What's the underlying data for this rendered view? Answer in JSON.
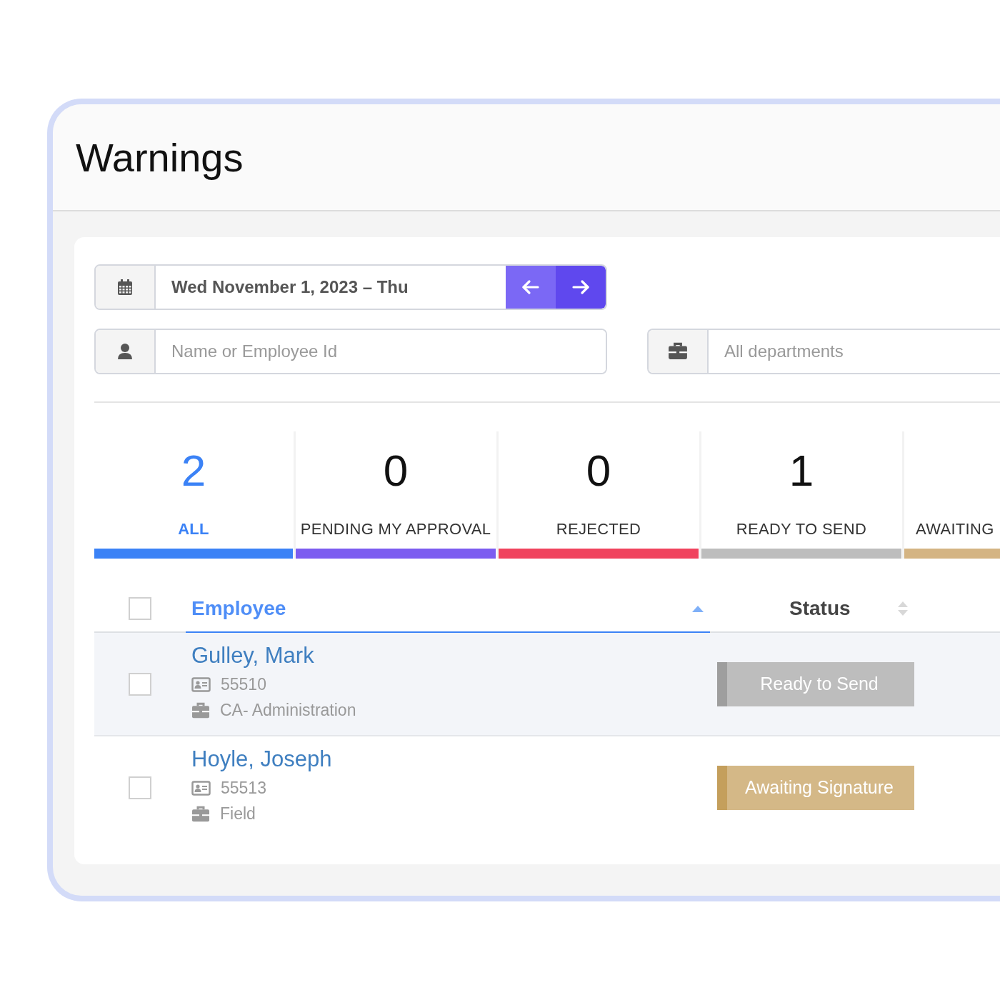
{
  "page": {
    "title": "Warnings"
  },
  "filters": {
    "date_range": "Wed November 1, 2023 – Thu",
    "search": {
      "placeholder": "Name or Employee Id"
    },
    "department": {
      "placeholder": "All departments"
    }
  },
  "tabs": [
    {
      "count": "2",
      "label": "ALL",
      "selected": true,
      "color": "#3b82f6"
    },
    {
      "count": "0",
      "label": "PENDING MY APPROVAL",
      "selected": false,
      "color": "#7c5cf0"
    },
    {
      "count": "0",
      "label": "REJECTED",
      "selected": false,
      "color": "#f0435e"
    },
    {
      "count": "1",
      "label": "READY TO SEND",
      "selected": false,
      "color": "#bdbdbd"
    },
    {
      "label": "AWAITING",
      "selected": false,
      "color": "#d4b483"
    }
  ],
  "table": {
    "select_all_checked": false,
    "columns": [
      {
        "label": "Employee",
        "sorted": true
      },
      {
        "label": "Status",
        "sorted": false
      }
    ],
    "rows": [
      {
        "name": "Gulley, Mark",
        "employee_id": "55510",
        "department": "CA- Administration",
        "checked": false,
        "highlighted": true,
        "status": {
          "label": "Ready to Send",
          "kind": "ready"
        }
      },
      {
        "name": "Hoyle, Joseph",
        "employee_id": "55513",
        "department": "Field",
        "checked": false,
        "highlighted": false,
        "status": {
          "label": "Awaiting Signature",
          "kind": "awaiting"
        }
      }
    ]
  }
}
